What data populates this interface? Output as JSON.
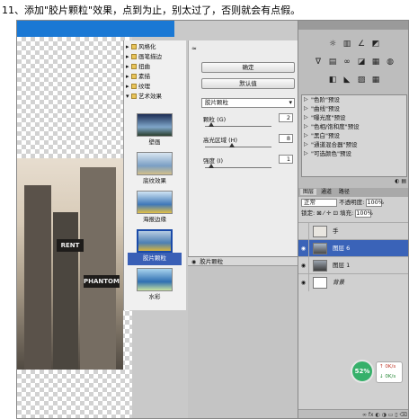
{
  "caption": "11、添加\"胶片颗粒\"效果，点到为止，别太过了，否则就会有点假。",
  "gallery": {
    "categories": [
      "风格化",
      "画笔描边",
      "扭曲",
      "素描",
      "纹理",
      "艺术效果"
    ],
    "filters": [
      "壁画",
      "底纹效果",
      "海报边缘",
      "胶片颗粒",
      "水彩"
    ],
    "selected_filter": "胶片颗粒"
  },
  "settings": {
    "ok_label": "确定",
    "default_label": "默认值",
    "filter_select": "胶片颗粒",
    "params": [
      {
        "label": "颗粒 (G)",
        "value": "2",
        "level": 0.1
      },
      {
        "label": "高光区域 (H)",
        "value": "8",
        "level": 0.4
      },
      {
        "label": "强度 (I)",
        "value": "1",
        "level": 0.1
      }
    ]
  },
  "effect_layers": {
    "header": "胶片颗粒"
  },
  "photo_signs": [
    "RENT",
    "PHANTOM"
  ],
  "adjustments": {
    "presets": [
      "\"色阶\"预设",
      "\"曲线\"预设",
      "\"曝光度\"预设",
      "\"色相/饱和度\"预设",
      "\"黑白\"预设",
      "\"通道混合器\"预设",
      "\"可选颜色\"预设"
    ],
    "icons_row1": [
      "☼",
      "▥",
      "∠",
      "◩"
    ],
    "icons_row2": [
      "∇",
      "▤",
      "∞",
      "◪",
      "▦",
      "◍"
    ],
    "icons_row3": [
      "◧",
      "◣",
      "▨",
      "▦"
    ]
  },
  "layers": {
    "tabs": [
      "图层",
      "通道",
      "路径"
    ],
    "blend_mode": "正常",
    "opacity_label": "不透明度:",
    "opacity": "100%",
    "lock_label": "锁定:",
    "lock_icons": "⊠ ⁄ ✛ ⊡",
    "fill_label": "填充:",
    "fill": "100%",
    "items": [
      {
        "name": "手",
        "visible": false
      },
      {
        "name": "图层 6",
        "visible": true,
        "selected": true
      },
      {
        "name": "图层 1",
        "visible": true
      },
      {
        "name": "背景",
        "visible": true
      }
    ],
    "footer_icons": "∞ fx ◐ ◑ ▭ ▯ ⌫"
  },
  "system": {
    "cpu": "52%",
    "up": "0K/s",
    "down": "0K/s"
  }
}
